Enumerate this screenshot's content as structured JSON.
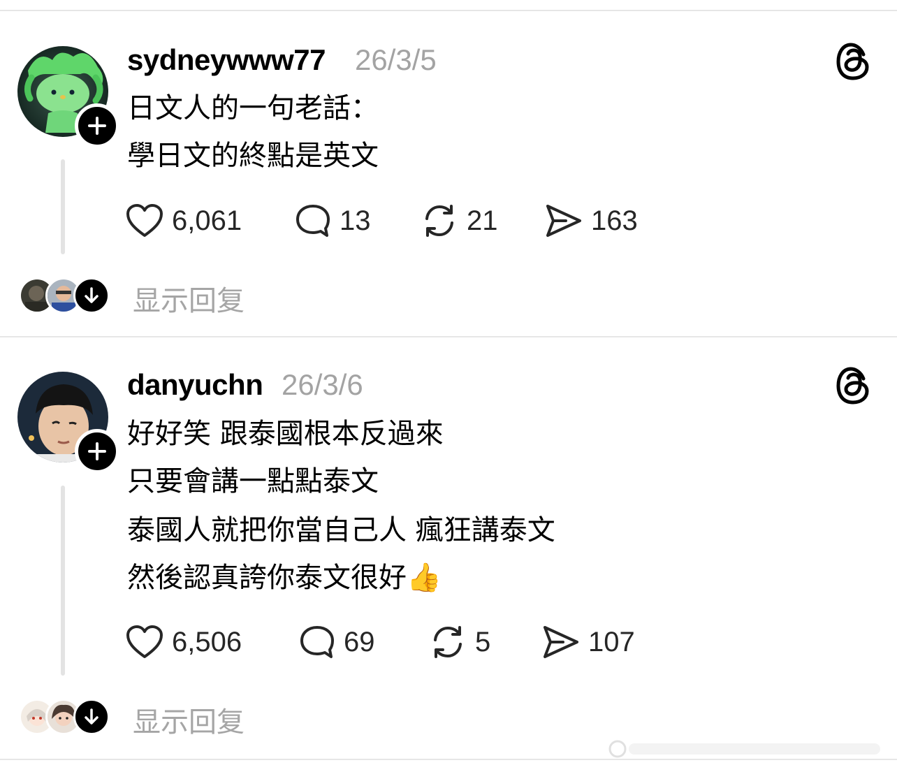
{
  "posts": [
    {
      "username": "sydneywww77",
      "date": "26/3/5",
      "lines": [
        "日文人的一句老話：",
        "學日文的終點是英文"
      ],
      "likes": "6,061",
      "comments": "13",
      "reposts": "21",
      "shares": "163",
      "show_replies": "显示回复"
    },
    {
      "username": "danyuchn",
      "date": "26/3/6",
      "lines": [
        "好好笑 跟泰國根本反過來",
        "只要會講一點點泰文",
        "泰國人就把你當自己人 瘋狂講泰文",
        "然後認真誇你泰文很好"
      ],
      "emoji": "👍",
      "likes": "6,506",
      "comments": "69",
      "reposts": "5",
      "shares": "107",
      "show_replies": "显示回复"
    }
  ],
  "icons": [
    "heart-icon",
    "comment-icon",
    "repost-icon",
    "share-icon",
    "threads-logo-icon",
    "plus-icon",
    "arrow-down-icon"
  ],
  "colors": {
    "text": "#000000",
    "muted": "#a3a3a3",
    "divider": "#e6e6e6"
  }
}
